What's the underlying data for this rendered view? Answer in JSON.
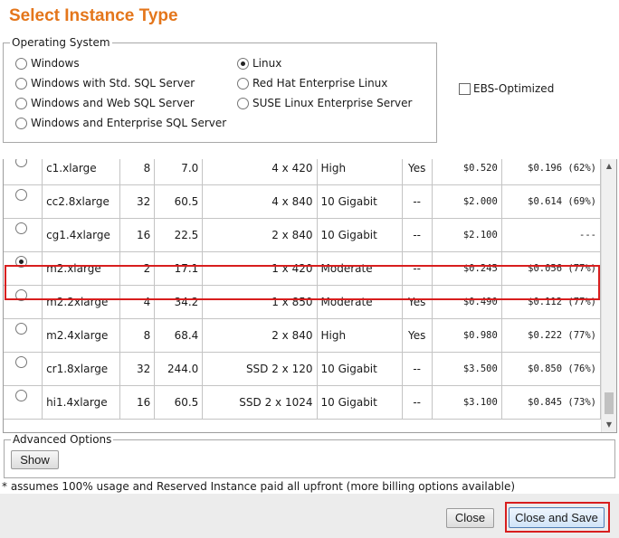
{
  "dialog": {
    "title": "Select Instance Type"
  },
  "os": {
    "legend": "Operating System",
    "options_left": [
      {
        "label": "Windows",
        "checked": false
      },
      {
        "label": "Windows with Std. SQL Server",
        "checked": false
      },
      {
        "label": "Windows and Web SQL Server",
        "checked": false
      },
      {
        "label": "Windows and Enterprise SQL Server",
        "checked": false
      }
    ],
    "options_right": [
      {
        "label": "Linux",
        "checked": true
      },
      {
        "label": "Red Hat Enterprise Linux",
        "checked": false
      },
      {
        "label": "SUSE Linux Enterprise Server",
        "checked": false
      }
    ]
  },
  "ebs_optimized": {
    "label": "EBS-Optimized",
    "checked": false
  },
  "instances": [
    {
      "name": "c1.xlarge",
      "cpu": "8",
      "memory": "7.0",
      "storage": "4 x 420",
      "network": "High",
      "ebs": "Yes",
      "price": "$0.520",
      "reserved": "$0.196 (62%)",
      "selected": false
    },
    {
      "name": "cc2.8xlarge",
      "cpu": "32",
      "memory": "60.5",
      "storage": "4 x 840",
      "network": "10 Gigabit",
      "ebs": "--",
      "price": "$2.000",
      "reserved": "$0.614 (69%)",
      "selected": false
    },
    {
      "name": "cg1.4xlarge",
      "cpu": "16",
      "memory": "22.5",
      "storage": "2 x 840",
      "network": "10 Gigabit",
      "ebs": "--",
      "price": "$2.100",
      "reserved": "---",
      "selected": false
    },
    {
      "name": "m2.xlarge",
      "cpu": "2",
      "memory": "17.1",
      "storage": "1 x 420",
      "network": "Moderate",
      "ebs": "--",
      "price": "$0.245",
      "reserved": "$0.056 (77%)",
      "selected": true
    },
    {
      "name": "m2.2xlarge",
      "cpu": "4",
      "memory": "34.2",
      "storage": "1 x 850",
      "network": "Moderate",
      "ebs": "Yes",
      "price": "$0.490",
      "reserved": "$0.112 (77%)",
      "selected": false
    },
    {
      "name": "m2.4xlarge",
      "cpu": "8",
      "memory": "68.4",
      "storage": "2 x 840",
      "network": "High",
      "ebs": "Yes",
      "price": "$0.980",
      "reserved": "$0.222 (77%)",
      "selected": false
    },
    {
      "name": "cr1.8xlarge",
      "cpu": "32",
      "memory": "244.0",
      "storage": "SSD 2 x 120",
      "network": "10 Gigabit",
      "ebs": "--",
      "price": "$3.500",
      "reserved": "$0.850 (76%)",
      "selected": false
    },
    {
      "name": "hi1.4xlarge",
      "cpu": "16",
      "memory": "60.5",
      "storage": "SSD 2 x 1024",
      "network": "10 Gigabit",
      "ebs": "--",
      "price": "$3.100",
      "reserved": "$0.845 (73%)",
      "selected": false
    }
  ],
  "advanced": {
    "legend": "Advanced Options",
    "show_label": "Show"
  },
  "footnote": "* assumes 100% usage and Reserved Instance paid all upfront (more billing options available)",
  "footer": {
    "close_label": "Close",
    "save_label": "Close and Save"
  },
  "icons": {
    "scroll_up": "▲",
    "scroll_down": "▼"
  },
  "colors": {
    "title": "#e4761b",
    "highlight": "#d81e1e"
  }
}
